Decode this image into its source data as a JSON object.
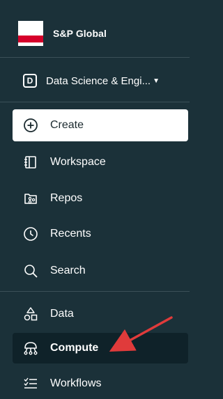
{
  "brand": {
    "name": "S&P Global",
    "logo_colors": {
      "top": "#ffffff",
      "band": "#d6002a"
    }
  },
  "workspace": {
    "badge": "D",
    "label": "Data Science & Engi...",
    "caret": "▼"
  },
  "nav": {
    "create": {
      "label": "Create",
      "icon": "plus-circle-icon"
    },
    "workspace": {
      "label": "Workspace",
      "icon": "folder-icon"
    },
    "repos": {
      "label": "Repos",
      "icon": "repos-icon"
    },
    "recents": {
      "label": "Recents",
      "icon": "clock-icon"
    },
    "search": {
      "label": "Search",
      "icon": "search-icon"
    },
    "data": {
      "label": "Data",
      "icon": "data-shapes-icon"
    },
    "compute": {
      "label": "Compute",
      "icon": "compute-icon"
    },
    "workflows": {
      "label": "Workflows",
      "icon": "workflows-icon"
    }
  },
  "colors": {
    "sidebar_bg": "#1b3139",
    "active_bg": "#0f2229",
    "annotation_arrow": "#e03b3b"
  }
}
